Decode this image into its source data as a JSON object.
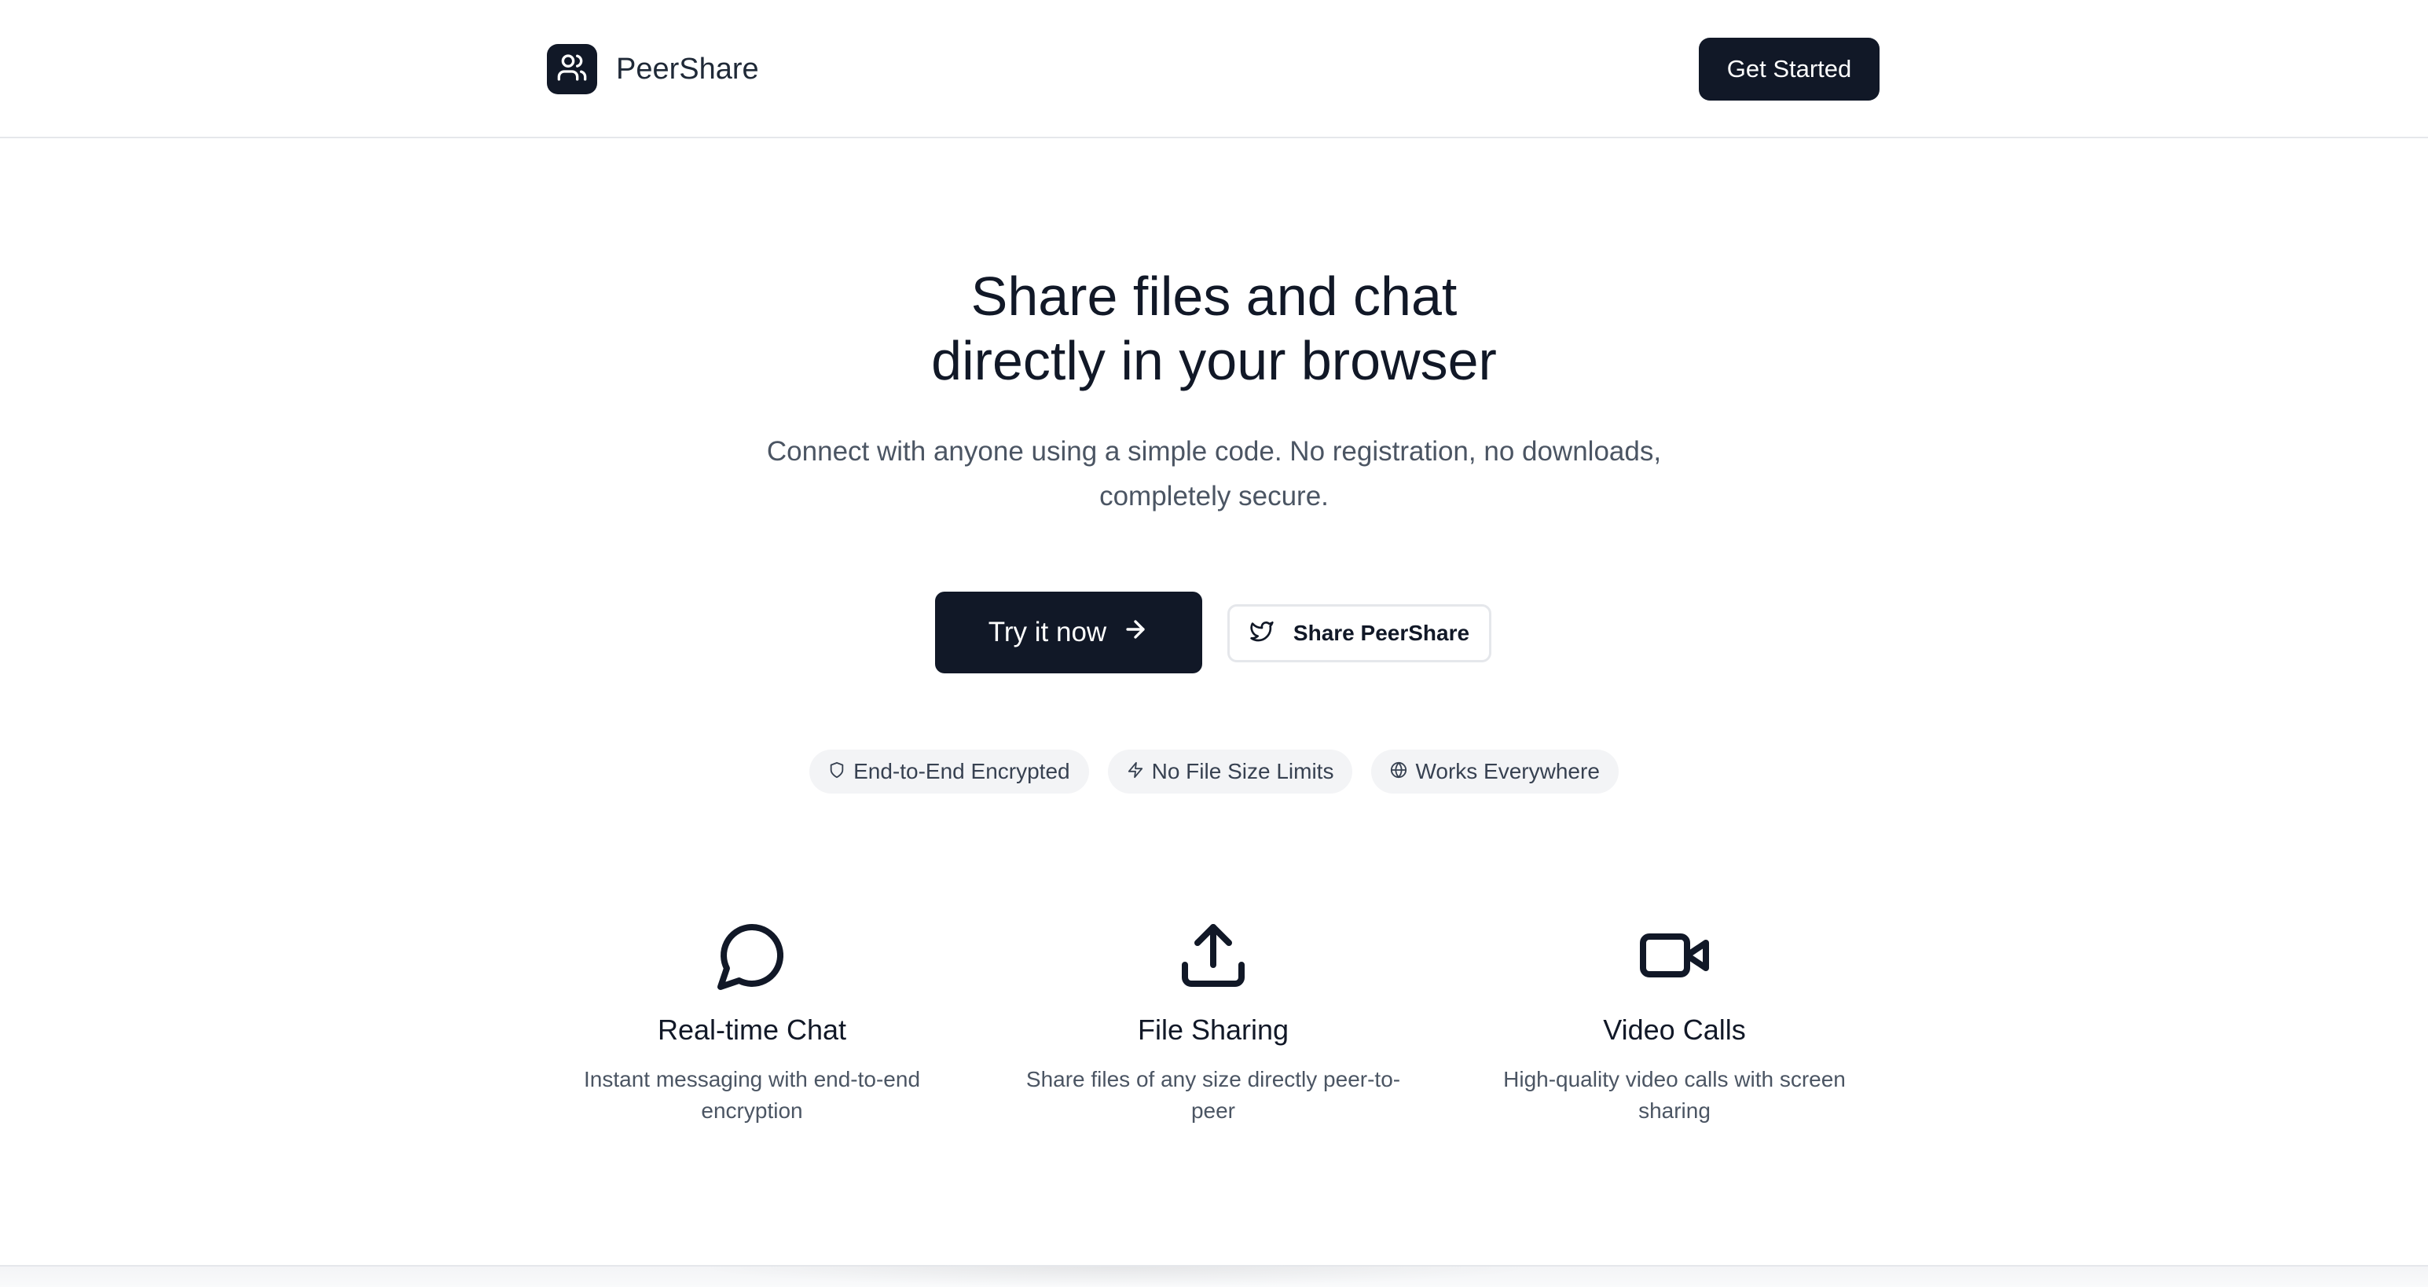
{
  "header": {
    "brand": "PeerShare",
    "cta_label": "Get Started",
    "logo_icon": "users-icon"
  },
  "hero": {
    "title_line1": "Share files and chat",
    "title_line2": "directly in your browser",
    "subtitle": "Connect with anyone using a simple code. No registration, no downloads, completely secure.",
    "primary_button": "Try it now",
    "primary_button_icon": "arrow-right-icon",
    "secondary_button": "Share PeerShare",
    "secondary_button_icon": "twitter-icon"
  },
  "badges": [
    {
      "icon": "shield-icon",
      "label": "End-to-End Encrypted"
    },
    {
      "icon": "zap-icon",
      "label": "No File Size Limits"
    },
    {
      "icon": "globe-icon",
      "label": "Works Everywhere"
    }
  ],
  "features": [
    {
      "icon": "message-circle-icon",
      "title": "Real-time Chat",
      "description": "Instant messaging with end-to-end encryption"
    },
    {
      "icon": "upload-icon",
      "title": "File Sharing",
      "description": "Share files of any size directly peer-to-peer"
    },
    {
      "icon": "video-icon",
      "title": "Video Calls",
      "description": "High-quality video calls with screen sharing"
    }
  ],
  "colors": {
    "primary": "#111827",
    "muted_text": "#4b5563",
    "badge_bg": "#f3f4f6",
    "border": "#e5e7eb"
  }
}
